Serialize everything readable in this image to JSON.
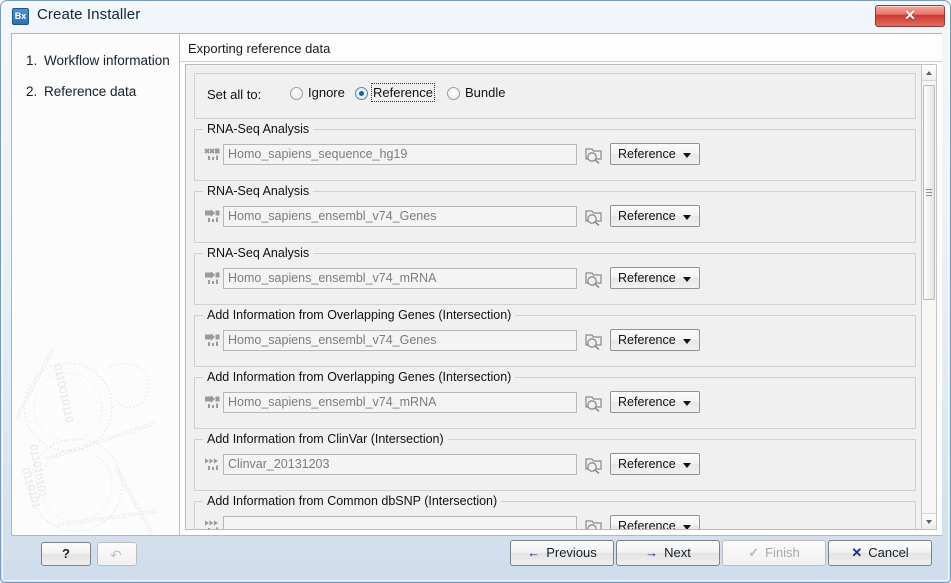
{
  "window": {
    "title": "Create Installer",
    "app_icon_label": "Bx",
    "close_label": "✕",
    "close_color": "#c93b32"
  },
  "nav": {
    "items": [
      {
        "num": "1.",
        "label": "Workflow information"
      },
      {
        "num": "2.",
        "label": "Reference data"
      }
    ]
  },
  "panel": {
    "title": "Exporting reference data",
    "set_all": {
      "label": "Set all to:",
      "options": [
        {
          "label": "Ignore",
          "selected": false
        },
        {
          "label": "Reference",
          "selected": true
        },
        {
          "label": "Bundle",
          "selected": false
        }
      ]
    },
    "rows": [
      {
        "group_label": "RNA-Seq Analysis",
        "icon": "sequence-track-icon",
        "value": "Homo_sapiens_sequence_hg19",
        "browse_icon": "browse-folder-icon",
        "mode": "Reference"
      },
      {
        "group_label": "RNA-Seq Analysis",
        "icon": "annotation-track-icon",
        "value": "Homo_sapiens_ensembl_v74_Genes",
        "browse_icon": "browse-folder-icon",
        "mode": "Reference"
      },
      {
        "group_label": "RNA-Seq Analysis",
        "icon": "annotation-track-icon",
        "value": "Homo_sapiens_ensembl_v74_mRNA",
        "browse_icon": "browse-folder-icon",
        "mode": "Reference"
      },
      {
        "group_label": "Add Information from Overlapping Genes (Intersection)",
        "icon": "annotation-track-icon",
        "value": "Homo_sapiens_ensembl_v74_Genes",
        "browse_icon": "browse-folder-icon",
        "mode": "Reference"
      },
      {
        "group_label": "Add Information from Overlapping Genes (Intersection)",
        "icon": "annotation-track-icon",
        "value": "Homo_sapiens_ensembl_v74_mRNA",
        "browse_icon": "browse-folder-icon",
        "mode": "Reference"
      },
      {
        "group_label": "Add Information from ClinVar (Intersection)",
        "icon": "variant-track-icon",
        "value": "Clinvar_20131203",
        "browse_icon": "browse-folder-icon",
        "mode": "Reference"
      },
      {
        "group_label": "Add Information from Common dbSNP (Intersection)",
        "icon": "variant-track-icon",
        "value": "",
        "browse_icon": "browse-folder-icon",
        "mode": "Reference"
      }
    ]
  },
  "scrollbar": {
    "up_label": "scroll-up",
    "down_label": "scroll-down"
  },
  "bottom": {
    "help_label": "?",
    "undo_label": "↶",
    "previous_label": "Previous",
    "previous_glyph": "←",
    "next_label": "Next",
    "next_glyph": "→",
    "finish_label": "Finish",
    "finish_glyph": "✓",
    "finish_enabled": false,
    "cancel_label": "Cancel",
    "cancel_glyph": "✕"
  }
}
